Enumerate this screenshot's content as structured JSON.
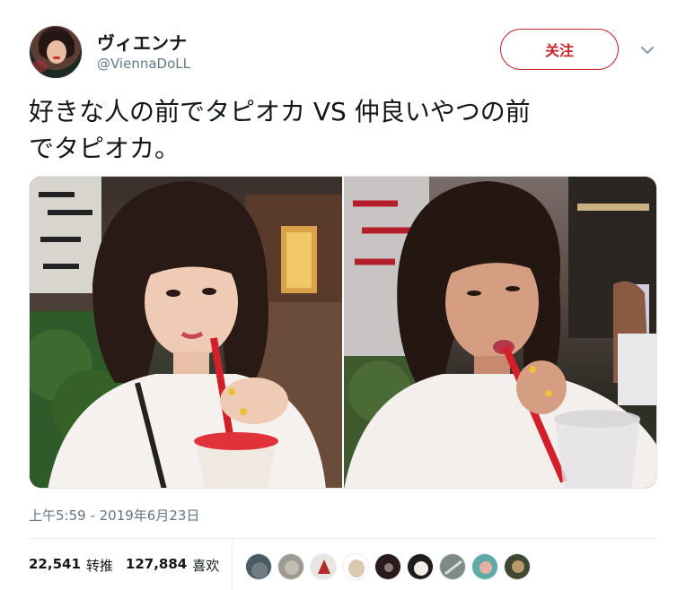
{
  "author": {
    "display_name": "ヴィエンナ",
    "handle": "@ViennaDoLL",
    "avatar_icon": "profile-avatar"
  },
  "follow_button": {
    "label": "关注",
    "color": "#c8252f"
  },
  "menu": {
    "icon": "chevron-down-icon"
  },
  "tweet": {
    "text_line1": "好きな人の前でタピオカ VS 仲良いやつの前",
    "text_line2": "でタピオカ。"
  },
  "media": {
    "images": [
      {
        "name": "photo-left",
        "subject": "woman drinking bubble tea with red straw"
      },
      {
        "name": "photo-right",
        "subject": "woman drinking bubble tea with red straw"
      }
    ]
  },
  "timestamp": "上午5:59 - 2019年6月23日",
  "stats": {
    "retweets_count": "22,541",
    "retweets_label": "转推",
    "likes_count": "127,884",
    "likes_label": "喜欢"
  },
  "likers": [
    {
      "color": "#4a5a62"
    },
    {
      "color": "#9d9a92"
    },
    {
      "color": "#e9e6e2"
    },
    {
      "color": "#d8c9b0"
    },
    {
      "color": "#2a1a1a"
    },
    {
      "color": "#1d1d1d"
    },
    {
      "color": "#7f8a86"
    },
    {
      "color": "#5fa9a8"
    },
    {
      "color": "#3e4730"
    }
  ]
}
